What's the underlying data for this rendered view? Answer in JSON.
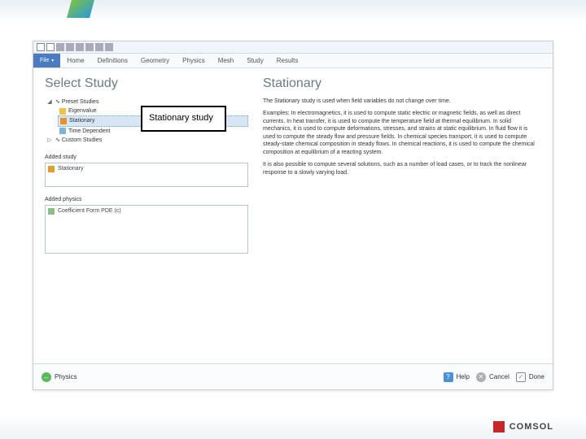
{
  "quickAccess": {
    "items": [
      "new",
      "open",
      "save",
      "undo",
      "redo",
      "copy",
      "paste",
      "delete"
    ]
  },
  "ribbon": {
    "file": "File",
    "tabs": [
      "Home",
      "Definitions",
      "Geometry",
      "Physics",
      "Mesh",
      "Study",
      "Results"
    ]
  },
  "leftPanel": {
    "title": "Select Study",
    "tree": {
      "presetLabel": "Preset Studies",
      "children": [
        {
          "label": "Eigenvalue",
          "icon": "study"
        },
        {
          "label": "Stationary",
          "icon": "stat",
          "selected": true
        },
        {
          "label": "Time Dependent",
          "icon": "time"
        }
      ],
      "customLabel": "Custom Studies"
    },
    "callout": "Stationary study",
    "addedStudy": {
      "label": "Added study",
      "items": [
        "Stationary"
      ]
    },
    "addedPhysics": {
      "label": "Added physics",
      "items": [
        "Coefficient Form PDE (c)"
      ]
    }
  },
  "rightPanel": {
    "title": "Stationary",
    "p1": "The Stationary study is used when field variables do not change over time.",
    "p2": "Examples: In electromagnetics, it is used to compute static electric or magnetic fields, as well as direct currents. In heat transfer, it is used to compute the temperature field at thermal equilibrium. In solid mechanics, it is used to compute deformations, stresses, and strains at static equilibrium. In fluid flow it is used to compute the steady flow and pressure fields. In chemical species transport, it is used to compute steady-state chemical composition in steady flows. In chemical reactions, it is used to compute the chemical composition at equilibrium of a reacting system.",
    "p3": "It is also possible to compute several solutions, such as a number of load cases, or to track the nonlinear response to a slowly varying load."
  },
  "bottomBar": {
    "back": "Physics",
    "help": "Help",
    "cancel": "Cancel",
    "done": "Done"
  },
  "footer": {
    "brand": "COMSOL"
  }
}
